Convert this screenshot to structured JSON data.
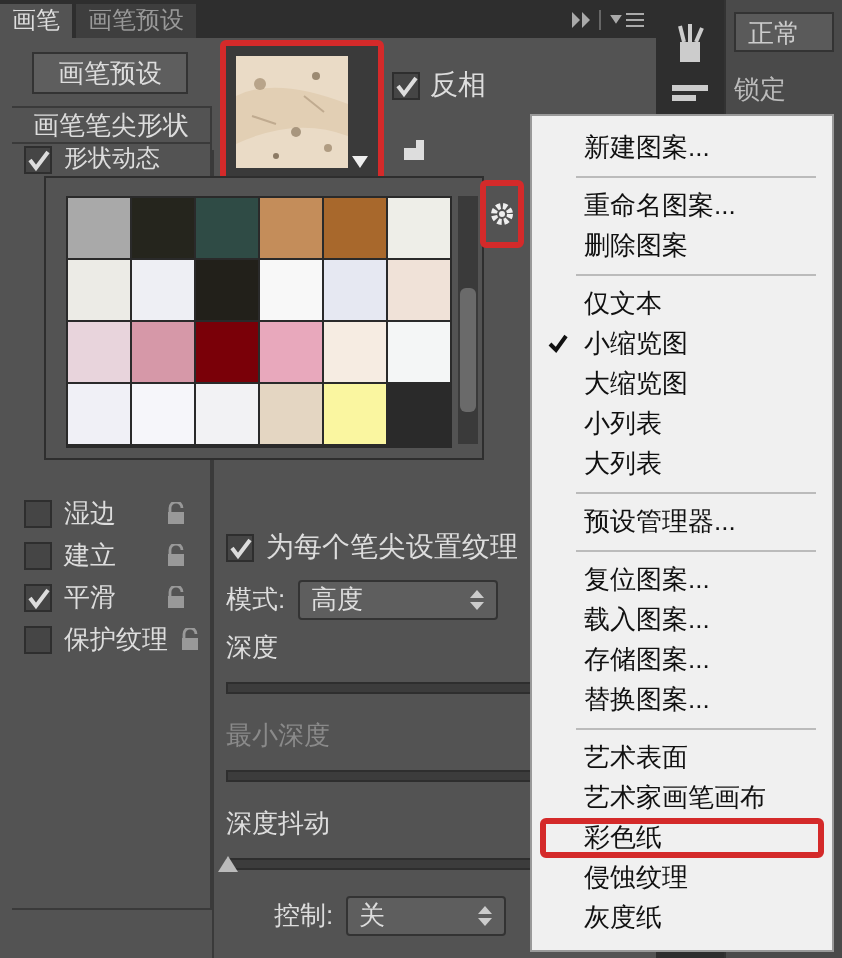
{
  "tabs": [
    {
      "label": "画笔",
      "selected": true
    },
    {
      "label": "画笔预设",
      "selected": false
    }
  ],
  "preset_button": "画笔预设",
  "brush_tip_shape": "画笔笔尖形状",
  "options_top": [
    {
      "label": "形状动态",
      "checked": true
    }
  ],
  "options": [
    {
      "label": "湿边",
      "checked": false
    },
    {
      "label": "建立",
      "checked": false
    },
    {
      "label": "平滑",
      "checked": true
    },
    {
      "label": "保护纹理",
      "checked": false
    }
  ],
  "invert": {
    "label": "反相",
    "checked": true
  },
  "texture_each_tip": {
    "label": "为每个笔尖设置纹理",
    "checked": true
  },
  "mode": {
    "label": "模式:",
    "value": "高度"
  },
  "depth": {
    "label": "深度"
  },
  "min_depth": {
    "label": "最小深度",
    "disabled": true
  },
  "depth_jitter": {
    "label": "深度抖动",
    "level": 0
  },
  "control": {
    "label": "控制:",
    "value": "关"
  },
  "pattern_picker": {
    "swatches": [
      {
        "color": "#a9a9a9"
      },
      {
        "color": "#25251d"
      },
      {
        "color": "#2f4b45"
      },
      {
        "color": "#c48d5a"
      },
      {
        "color": "#a8682c"
      },
      {
        "color": "#eeeee8"
      },
      {
        "color": "#ecebe6"
      },
      {
        "color": "#eeeff4"
      },
      {
        "color": "#22201a"
      },
      {
        "color": "#f8f8f8"
      },
      {
        "color": "#e6e8f2"
      },
      {
        "color": "#f0e2d8"
      },
      {
        "color": "#e8d4dc"
      },
      {
        "color": "#d698a8"
      },
      {
        "color": "#7a0008"
      },
      {
        "color": "#e8a8bc"
      },
      {
        "color": "#f6ece2"
      },
      {
        "color": "#f4f6f6"
      },
      {
        "color": "#f0f0f6"
      },
      {
        "color": "#f6f6fa"
      },
      {
        "color": "#f2f2f4"
      },
      {
        "color": "#e4d6c2"
      },
      {
        "color": "#faf6a0"
      }
    ]
  },
  "layers_panel": {
    "blend_mode": "正常",
    "lock_label": "锁定"
  },
  "menu": {
    "groups": [
      [
        {
          "label": "新建图案...",
          "checked": false,
          "highlighted": false
        }
      ],
      [
        {
          "label": "重命名图案...",
          "checked": false,
          "highlighted": false
        },
        {
          "label": "删除图案",
          "checked": false,
          "highlighted": false
        }
      ],
      [
        {
          "label": "仅文本",
          "checked": false,
          "highlighted": false
        },
        {
          "label": "小缩览图",
          "checked": true,
          "highlighted": false
        },
        {
          "label": "大缩览图",
          "checked": false,
          "highlighted": false
        },
        {
          "label": "小列表",
          "checked": false,
          "highlighted": false
        },
        {
          "label": "大列表",
          "checked": false,
          "highlighted": false
        }
      ],
      [
        {
          "label": "预设管理器...",
          "checked": false,
          "highlighted": false
        }
      ],
      [
        {
          "label": "复位图案...",
          "checked": false,
          "highlighted": false
        },
        {
          "label": "载入图案...",
          "checked": false,
          "highlighted": false
        },
        {
          "label": "存储图案...",
          "checked": false,
          "highlighted": false
        },
        {
          "label": "替换图案...",
          "checked": false,
          "highlighted": false
        }
      ],
      [
        {
          "label": "艺术表面",
          "checked": false,
          "highlighted": false
        },
        {
          "label": "艺术家画笔画布",
          "checked": false,
          "highlighted": false
        },
        {
          "label": "彩色纸",
          "checked": false,
          "highlighted": true
        },
        {
          "label": "侵蚀纹理",
          "checked": false,
          "highlighted": false
        },
        {
          "label": "灰度纸",
          "checked": false,
          "highlighted": false
        }
      ]
    ]
  }
}
